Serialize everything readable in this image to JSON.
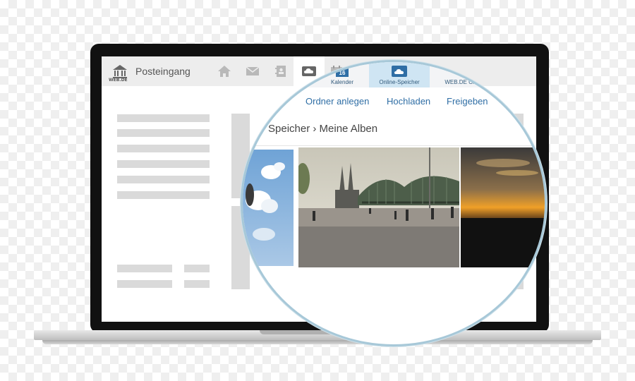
{
  "mail_header": {
    "logo_text": "WEB.DE",
    "inbox_label": "Posteingang"
  },
  "nav_icons": [
    "home-icon",
    "mail-icon",
    "contacts-icon",
    "cloud-icon",
    "calendar-icon"
  ],
  "magnifier": {
    "tabs": [
      {
        "label": "Kalender",
        "badge": "16"
      },
      {
        "label": "Online-Speicher"
      },
      {
        "label": "WEB.DE Cl"
      }
    ],
    "toolbar": {
      "new_folder": "Ordner anlegen",
      "upload": "Hochladen",
      "share": "Freigeben"
    },
    "breadcrumb": {
      "part1": "Speicher",
      "separator": "›",
      "part2": "Meine Alben"
    },
    "photos": [
      "sky-clouds-photo",
      "cologne-bridge-photo",
      "sunset-photo"
    ]
  },
  "colors": {
    "accent": "#2f6ea5",
    "active_tab": "#cfe5f3",
    "lens_ring": "#a7c8d8",
    "topbar": "#ededed"
  }
}
